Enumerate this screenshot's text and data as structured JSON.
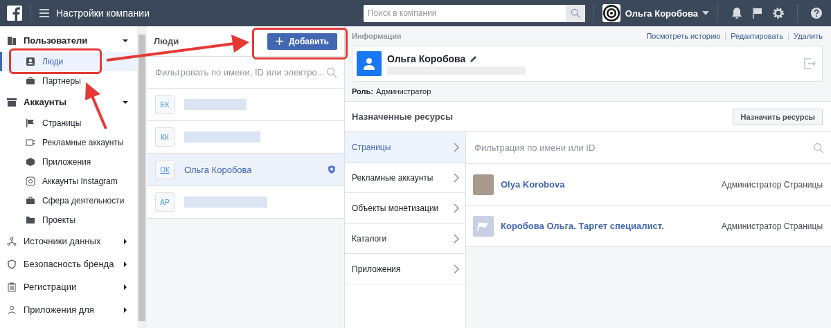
{
  "topbar": {
    "title": "Настройки компании",
    "search": {
      "placeholder": "Поиск в компании"
    },
    "user": "Ольга Коробова"
  },
  "sidebar": {
    "groups": [
      {
        "label": "Пользователи",
        "expanded": true,
        "children": [
          {
            "label": "Люди",
            "selected": true
          },
          {
            "label": "Партнеры",
            "selected": false
          }
        ]
      },
      {
        "label": "Аккаунты",
        "expanded": true,
        "children": [
          {
            "label": "Страницы",
            "selected": false
          },
          {
            "label": "Рекламные аккаунты",
            "selected": false
          },
          {
            "label": "Приложения",
            "selected": false
          },
          {
            "label": "Аккаунты Instagram",
            "selected": false
          },
          {
            "label": "Сфера деятельности",
            "selected": false
          },
          {
            "label": "Проекты",
            "selected": false
          }
        ]
      },
      {
        "label": "Источники данных",
        "expanded": false
      },
      {
        "label": "Безопасность бренда",
        "expanded": false
      },
      {
        "label": "Регистрации",
        "expanded": false
      },
      {
        "label": "Приложения для",
        "expanded": false
      }
    ]
  },
  "people": {
    "title": "Люди",
    "add_button": "Добавить",
    "filter": {
      "placeholder": "Фильтровать по имени, ID или электро..."
    },
    "rows": [
      {
        "initials": "ЕК",
        "selected": false,
        "admin": false
      },
      {
        "initials": "КК",
        "selected": false,
        "admin": false
      },
      {
        "initials": "ОК",
        "name": "Ольга Коробова",
        "selected": true,
        "admin": true
      },
      {
        "initials": "АР",
        "selected": false,
        "admin": false
      }
    ]
  },
  "info": {
    "title": "Информация",
    "actions": [
      {
        "kind": "link",
        "text": "Посмотреть историю"
      },
      {
        "kind": "separator",
        "text": "|"
      },
      {
        "kind": "link",
        "text": "Редактировать"
      },
      {
        "kind": "separator",
        "text": "|"
      },
      {
        "kind": "link",
        "text": "Удалить"
      }
    ],
    "name": "Ольга Коробова",
    "role_label": "Роль:",
    "role": "Администратор"
  },
  "assets": {
    "title": "Назначенные ресурсы",
    "assign_button": "Назначить ресурсы",
    "filter": {
      "placeholder": "Фильтрация по имени или ID"
    },
    "tabs": [
      {
        "label": "Страницы",
        "selected": true
      },
      {
        "label": "Рекламные аккаунты",
        "selected": false
      },
      {
        "label": "Объекты монетизации",
        "selected": false
      },
      {
        "label": "Каталоги",
        "selected": false
      },
      {
        "label": "Приложения",
        "selected": false
      }
    ],
    "items": [
      {
        "kind": "photo",
        "name": "Olya Korobova",
        "role": "Администратор Страницы"
      },
      {
        "kind": "page",
        "name": "Коробова Ольга. Таргет специалист.",
        "role": "Администратор Страницы"
      }
    ]
  }
}
